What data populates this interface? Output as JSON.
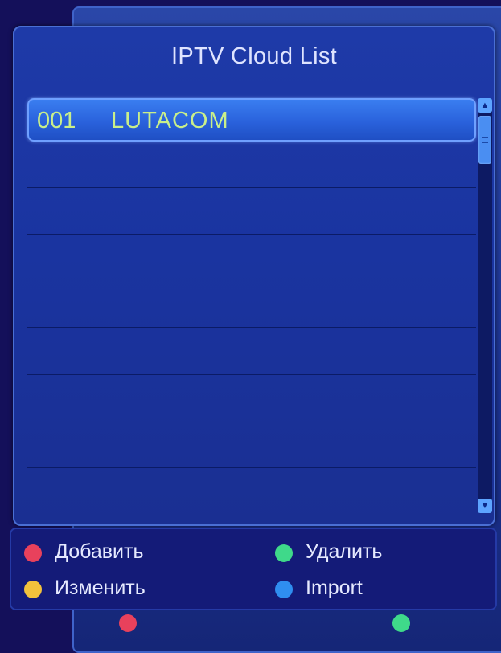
{
  "dialog": {
    "title": "IPTV Cloud List"
  },
  "list": {
    "items": [
      {
        "number": "001",
        "name": "LUTACOM",
        "selected": true
      }
    ],
    "empty_row_count": 8
  },
  "scrollbar": {
    "up_icon": "arrow-up-icon",
    "down_icon": "arrow-down-icon"
  },
  "footer": {
    "hints": [
      {
        "label": "Добавить",
        "color": "#e8415c",
        "icon": "red-key-icon"
      },
      {
        "label": "Удалить",
        "color": "#3fd98a",
        "icon": "green-key-icon"
      },
      {
        "label": "Изменить",
        "color": "#f2c23c",
        "icon": "yellow-key-icon"
      },
      {
        "label": "Import",
        "color": "#2f8ef0",
        "icon": "blue-key-icon"
      }
    ]
  },
  "colors": {
    "selected_text": "#c9ef8a",
    "title_text": "#dfe4ff",
    "dialog_bg": "#1e3aa8",
    "selection_bg": "#3a7ef0"
  }
}
